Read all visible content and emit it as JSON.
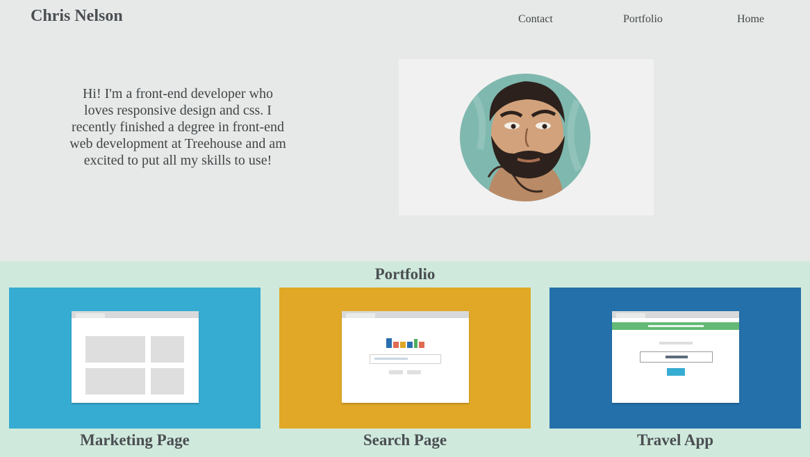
{
  "header": {
    "site_name": "Chris Nelson",
    "nav": [
      {
        "label": "Contact"
      },
      {
        "label": "Portfolio"
      },
      {
        "label": "Home"
      }
    ]
  },
  "intro": {
    "text": "Hi! I'm a front-end developer who loves responsive design and css. I recently finished a degree in front-end web development at Treehouse and am excited to put all my skills to use!"
  },
  "portfolio": {
    "heading": "Portfolio",
    "projects": [
      {
        "title": "Marketing Page",
        "color": "#36acd2",
        "icon": "marketing-page-mockup-icon"
      },
      {
        "title": "Search Page",
        "color": "#e0a826",
        "icon": "search-page-mockup-icon"
      },
      {
        "title": "Travel App",
        "color": "#2470aa",
        "icon": "travel-app-mockup-icon"
      }
    ]
  },
  "colors": {
    "page_background": "#e7e9e8",
    "portfolio_background": "#d0e9dd",
    "text": "#3f4446"
  }
}
